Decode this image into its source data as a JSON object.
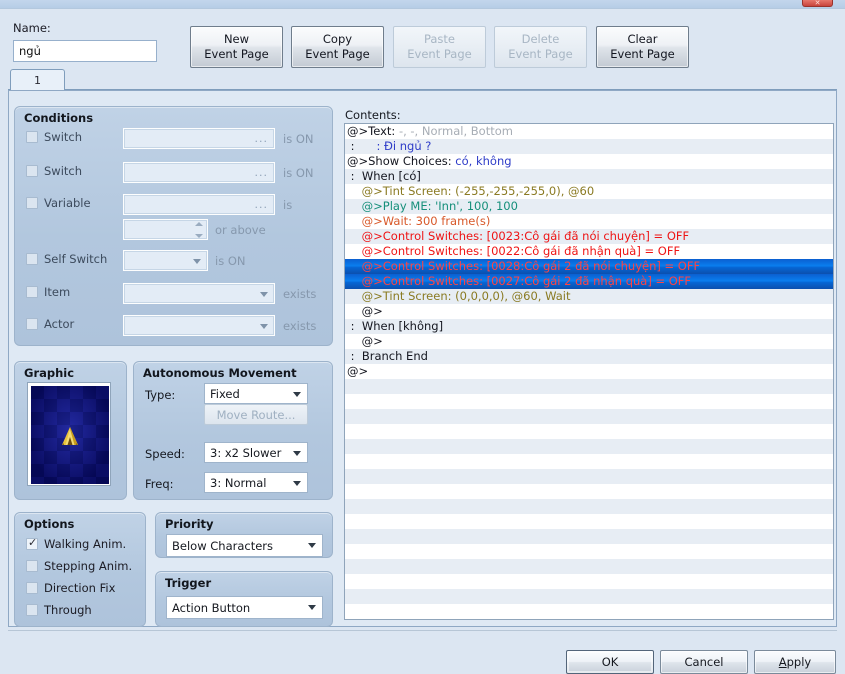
{
  "window": {
    "close_glyph": "✕"
  },
  "top": {
    "name_label": "Name:",
    "name_value": "ngủ",
    "buttons": [
      {
        "l1": "New",
        "l2": "Event Page",
        "enabled": true
      },
      {
        "l1": "Copy",
        "l2": "Event Page",
        "enabled": true
      },
      {
        "l1": "Paste",
        "l2": "Event Page",
        "enabled": false
      },
      {
        "l1": "Delete",
        "l2": "Event Page",
        "enabled": false
      },
      {
        "l1": "Clear",
        "l2": "Event Page",
        "enabled": true
      }
    ]
  },
  "tabs": [
    {
      "label": "1",
      "active": true
    }
  ],
  "conditions": {
    "title": "Conditions",
    "rows": [
      {
        "label": "Switch",
        "checked": false,
        "value": "",
        "unit": "is ON"
      },
      {
        "label": "Switch",
        "checked": false,
        "value": "",
        "unit": "is ON"
      },
      {
        "label": "Variable",
        "checked": false,
        "value": "",
        "unit": "is"
      },
      {
        "label": "",
        "checked": null,
        "value": "",
        "unit": "or above"
      },
      {
        "label": "Self Switch",
        "checked": false,
        "value": "",
        "unit": "is ON"
      },
      {
        "label": "Item",
        "checked": false,
        "value": "",
        "unit": "exists"
      },
      {
        "label": "Actor",
        "checked": false,
        "value": "",
        "unit": "exists"
      }
    ]
  },
  "graphic": {
    "title": "Graphic"
  },
  "movement": {
    "title": "Autonomous Movement",
    "type_label": "Type:",
    "type_value": "Fixed",
    "move_route_label": "Move Route...",
    "speed_label": "Speed:",
    "speed_value": "3: x2 Slower",
    "freq_label": "Freq:",
    "freq_value": "3: Normal"
  },
  "options": {
    "title": "Options",
    "items": [
      {
        "label": "Walking Anim.",
        "checked": true
      },
      {
        "label": "Stepping Anim.",
        "checked": false
      },
      {
        "label": "Direction Fix",
        "checked": false
      },
      {
        "label": "Through",
        "checked": false
      }
    ]
  },
  "priority": {
    "title": "Priority",
    "value": "Below Characters"
  },
  "trigger": {
    "title": "Trigger",
    "value": "Action Button"
  },
  "contents": {
    "label": "Contents:",
    "colors": {
      "default": "#14161f",
      "params": "#a7adb5",
      "text_line": "#2e3cc8",
      "tint": "#8a7a22",
      "music": "#158f7a",
      "wait": "#d8592a",
      "switches": "#ee1414",
      "selection": "#0a7ff0"
    },
    "rows": [
      {
        "indent": 0,
        "selected": false,
        "parts": [
          {
            "t": "@>Text: ",
            "c": "c-dark"
          },
          {
            "t": "-, -, Normal, Bottom",
            "c": "c-gray"
          }
        ]
      },
      {
        "indent": 0,
        "selected": false,
        "parts": [
          {
            "t": " :      ",
            "c": "c-dark"
          },
          {
            "t": ": Đi ngủ ?",
            "c": "c-blue"
          }
        ]
      },
      {
        "indent": 0,
        "selected": false,
        "parts": [
          {
            "t": "@>Show Choices: ",
            "c": "c-dark"
          },
          {
            "t": "có, không",
            "c": "c-blue"
          }
        ]
      },
      {
        "indent": 0,
        "selected": false,
        "parts": [
          {
            "t": " :  When [có]",
            "c": "c-dark"
          }
        ]
      },
      {
        "indent": 0,
        "selected": false,
        "parts": [
          {
            "t": "    @>Tint Screen: (-255,-255,-255,0), @60",
            "c": "c-olive"
          }
        ]
      },
      {
        "indent": 0,
        "selected": false,
        "parts": [
          {
            "t": "    @>Play ME: 'Inn', 100, 100",
            "c": "c-teal"
          }
        ]
      },
      {
        "indent": 0,
        "selected": false,
        "parts": [
          {
            "t": "    @>Wait: 300 frame(s)",
            "c": "c-orange"
          }
        ]
      },
      {
        "indent": 0,
        "selected": false,
        "parts": [
          {
            "t": "    @>Control Switches: [0023:Cô gái đã nói chuyện] = OFF",
            "c": "c-red"
          }
        ]
      },
      {
        "indent": 0,
        "selected": false,
        "parts": [
          {
            "t": "    @>Control Switches: [0022:Cô gái đã nhận quà] = OFF",
            "c": "c-red"
          }
        ]
      },
      {
        "indent": 0,
        "selected": true,
        "parts": [
          {
            "t": "    @>Control Switches: [0028:Cô gái 2 đã nói chuyện] = OFF",
            "c": "c-red"
          }
        ]
      },
      {
        "indent": 0,
        "selected": true,
        "parts": [
          {
            "t": "    @>Control Switches: [0027:Cô gái 2 đã nhận quà] = OFF",
            "c": "c-red"
          }
        ]
      },
      {
        "indent": 0,
        "selected": false,
        "parts": [
          {
            "t": "    @>Tint Screen: (0,0,0,0), @60, Wait",
            "c": "c-olive"
          }
        ]
      },
      {
        "indent": 0,
        "selected": false,
        "parts": [
          {
            "t": "    @>",
            "c": "c-dark"
          }
        ]
      },
      {
        "indent": 0,
        "selected": false,
        "parts": [
          {
            "t": " :  When [không]",
            "c": "c-dark"
          }
        ]
      },
      {
        "indent": 0,
        "selected": false,
        "parts": [
          {
            "t": "    @>",
            "c": "c-dark"
          }
        ]
      },
      {
        "indent": 0,
        "selected": false,
        "parts": [
          {
            "t": " :  Branch End",
            "c": "c-dark"
          }
        ]
      },
      {
        "indent": 0,
        "selected": false,
        "parts": [
          {
            "t": "@>",
            "c": "c-dark"
          }
        ]
      }
    ]
  },
  "footer": {
    "ok": "OK",
    "cancel": "Cancel",
    "apply_accel": "A",
    "apply_rest": "pply"
  }
}
